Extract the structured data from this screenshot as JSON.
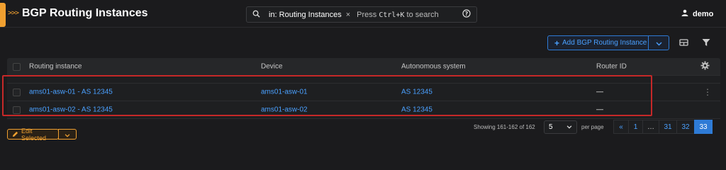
{
  "header": {
    "chevron": ">>>",
    "title": "BGP Routing Instances",
    "search": {
      "chip": "in: Routing Instances",
      "chip_close": "×",
      "hint_prefix": "Press",
      "hint_key": "Ctrl+K",
      "hint_suffix": "to search"
    },
    "user": "demo"
  },
  "toolbar": {
    "add_label": "Add BGP Routing Instance"
  },
  "table": {
    "columns": [
      "Routing instance",
      "Device",
      "Autonomous system",
      "Router ID"
    ],
    "rows": [
      {
        "instance": "ams01-asw-01 - AS 12345",
        "device": "ams01-asw-01",
        "asn": "AS 12345",
        "router_id": "—"
      },
      {
        "instance": "ams01-asw-02 - AS 12345",
        "device": "ams01-asw-02",
        "asn": "AS 12345",
        "router_id": "—"
      }
    ]
  },
  "footer": {
    "edit_label": "Edit Selected",
    "showing": "Showing 161-162 of 162",
    "per_page_value": "5",
    "per_page_label": "per page",
    "pages": [
      "«",
      "1",
      "…",
      "31",
      "32",
      "33"
    ],
    "active_page": "33"
  },
  "colors": {
    "accent": "#f0a030",
    "link": "#4aa0ff",
    "primary": "#2e7bd6",
    "highlight": "#c62828"
  }
}
